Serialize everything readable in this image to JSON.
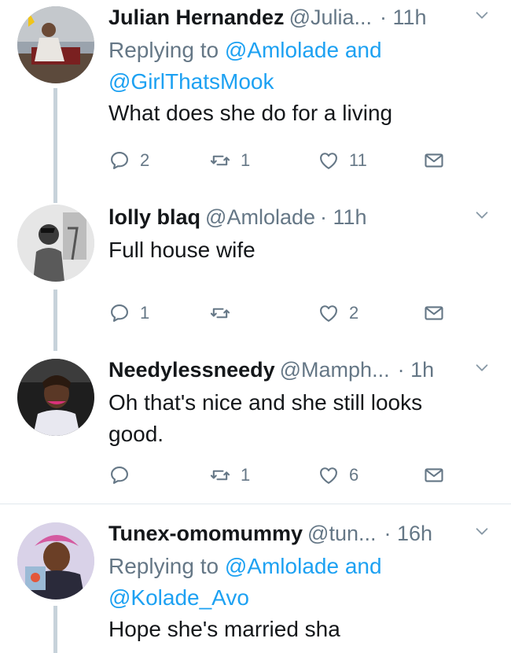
{
  "tweets": [
    {
      "name": "Julian Hernandez",
      "handle": "@Julia...",
      "time": "· 11h",
      "reply_label": "Replying to",
      "reply_first": "@Amlolade",
      "reply_and": "and",
      "reply_second": "@GirlThatsMook",
      "text": "What does she do for a living",
      "replies": "2",
      "retweets": "1",
      "likes": "11"
    },
    {
      "name": "lolly blaq",
      "handle": "@Amlolade",
      "time": "· 11h",
      "text": "Full house wife",
      "replies": "1",
      "retweets": "",
      "likes": "2"
    },
    {
      "name": "Needylessneedy",
      "handle": "@Mamph...",
      "time": "· 1h",
      "text_line1": "Oh that's nice and she still looks",
      "text_line2": "good.",
      "replies": "",
      "retweets": "1",
      "likes": "6"
    },
    {
      "name": "Tunex-omomummy",
      "handle": "@tun...",
      "time": "· 16h",
      "reply_label": "Replying to",
      "reply_first": "@Amlolade",
      "reply_and": "and",
      "reply_second": "@Kolade_Avo",
      "text": "Hope she's married sha"
    }
  ],
  "icons": {
    "reply": "reply-bubble-icon",
    "retweet": "retweet-icon",
    "like": "heart-icon",
    "dm": "envelope-icon",
    "menu": "chevron-down-icon"
  },
  "colors": {
    "link": "#1da1f2",
    "muted": "#657786",
    "text": "#14171a",
    "thread_line": "#c7d2da"
  }
}
